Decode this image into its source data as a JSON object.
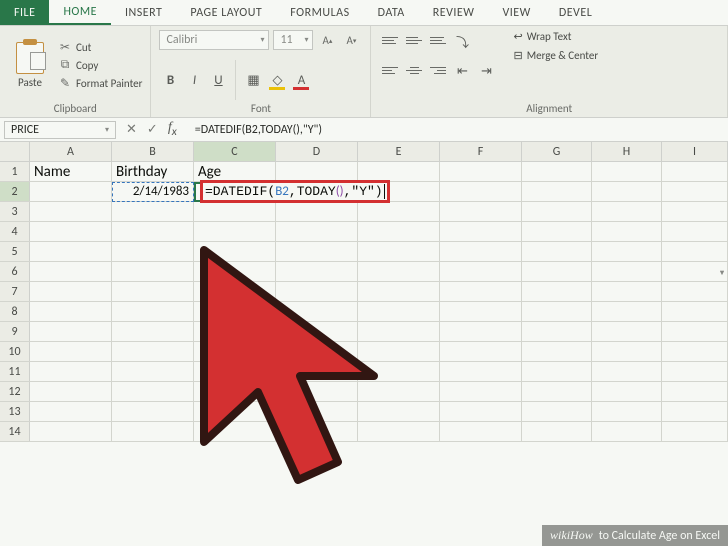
{
  "tabs": {
    "file": "FILE",
    "home": "HOME",
    "insert": "INSERT",
    "pagelayout": "PAGE LAYOUT",
    "formulas": "FORMULAS",
    "data": "DATA",
    "review": "REVIEW",
    "view": "VIEW",
    "developer": "DEVEL"
  },
  "ribbon": {
    "clipboard": {
      "paste": "Paste",
      "cut": "Cut",
      "copy": "Copy",
      "format_painter": "Format Painter",
      "group_label": "Clipboard"
    },
    "font": {
      "family": "Calibri",
      "size": "11",
      "group_label": "Font"
    },
    "alignment": {
      "wrap": "Wrap Text",
      "merge": "Merge & Center",
      "group_label": "Alignment"
    }
  },
  "name_box": "PRICE",
  "formula_bar": "=DATEDIF(B2,TODAY(),\"Y\")",
  "columns": [
    "A",
    "B",
    "C",
    "D",
    "E",
    "F",
    "G",
    "H",
    "I"
  ],
  "headers": {
    "A": "Name",
    "B": "Birthday",
    "C": "Age"
  },
  "data_row": {
    "B": "2/14/1983",
    "C_formula": "=DATEDIF(B2,TODAY(),\"Y\")"
  },
  "active_cell": "C2",
  "watermark": {
    "brand": "wikiHow",
    "title": "to Calculate Age on Excel"
  }
}
